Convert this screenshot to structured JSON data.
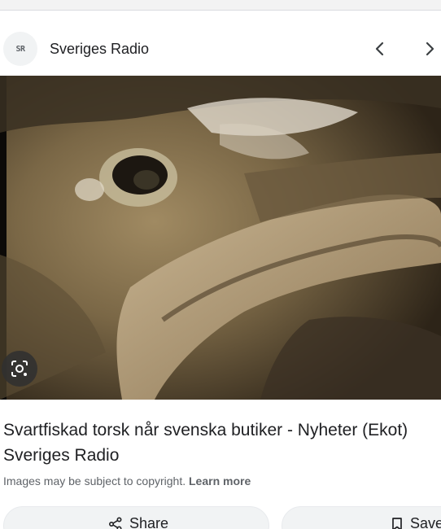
{
  "source": {
    "favicon_text": "SR",
    "name": "Sveriges Radio"
  },
  "navigation": {
    "prev_icon": "chevron-left-icon",
    "next_icon": "chevron-right-icon"
  },
  "image": {
    "lens_icon": "lens-icon"
  },
  "result": {
    "title_line1": "Svartfiskad torsk når svenska butiker - Nyheter (Ekot)",
    "title_line2": "Sveriges Radio"
  },
  "copyright": {
    "text": "Images may be subject to copyright. ",
    "link": "Learn more"
  },
  "actions": {
    "share_label": "Share",
    "save_label": "Save"
  }
}
